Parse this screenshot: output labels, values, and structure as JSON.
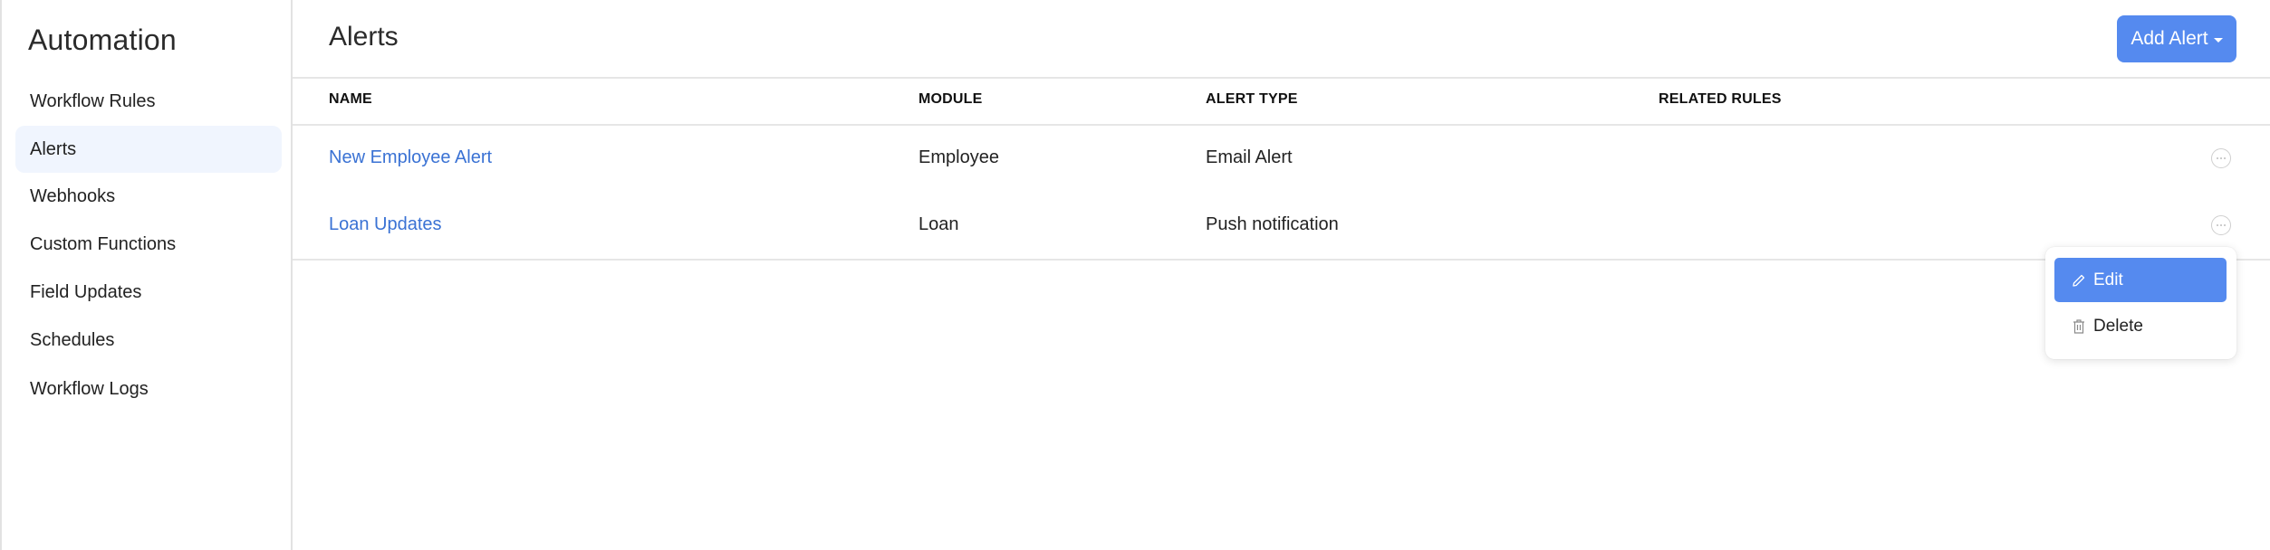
{
  "sidebar": {
    "title": "Automation",
    "items": [
      {
        "label": "Workflow Rules",
        "active": false
      },
      {
        "label": "Alerts",
        "active": true
      },
      {
        "label": "Webhooks",
        "active": false
      },
      {
        "label": "Custom Functions",
        "active": false
      },
      {
        "label": "Field Updates",
        "active": false
      },
      {
        "label": "Schedules",
        "active": false
      },
      {
        "label": "Workflow Logs",
        "active": false
      }
    ]
  },
  "header": {
    "title": "Alerts",
    "add_button_label": "Add Alert"
  },
  "table": {
    "columns": [
      "NAME",
      "MODULE",
      "ALERT TYPE",
      "RELATED RULES"
    ],
    "rows": [
      {
        "name": "New Employee Alert",
        "module": "Employee",
        "alert_type": "Email Alert",
        "related_rules": ""
      },
      {
        "name": "Loan Updates",
        "module": "Loan",
        "alert_type": "Push notification",
        "related_rules": ""
      }
    ]
  },
  "row_menu": {
    "items": [
      {
        "label": "Edit",
        "icon": "pencil-icon",
        "highlighted": true
      },
      {
        "label": "Delete",
        "icon": "trash-icon",
        "highlighted": false
      }
    ]
  },
  "colors": {
    "accent": "#558aef",
    "link": "#3a72d4",
    "active_nav_bg": "#f0f5fe"
  }
}
